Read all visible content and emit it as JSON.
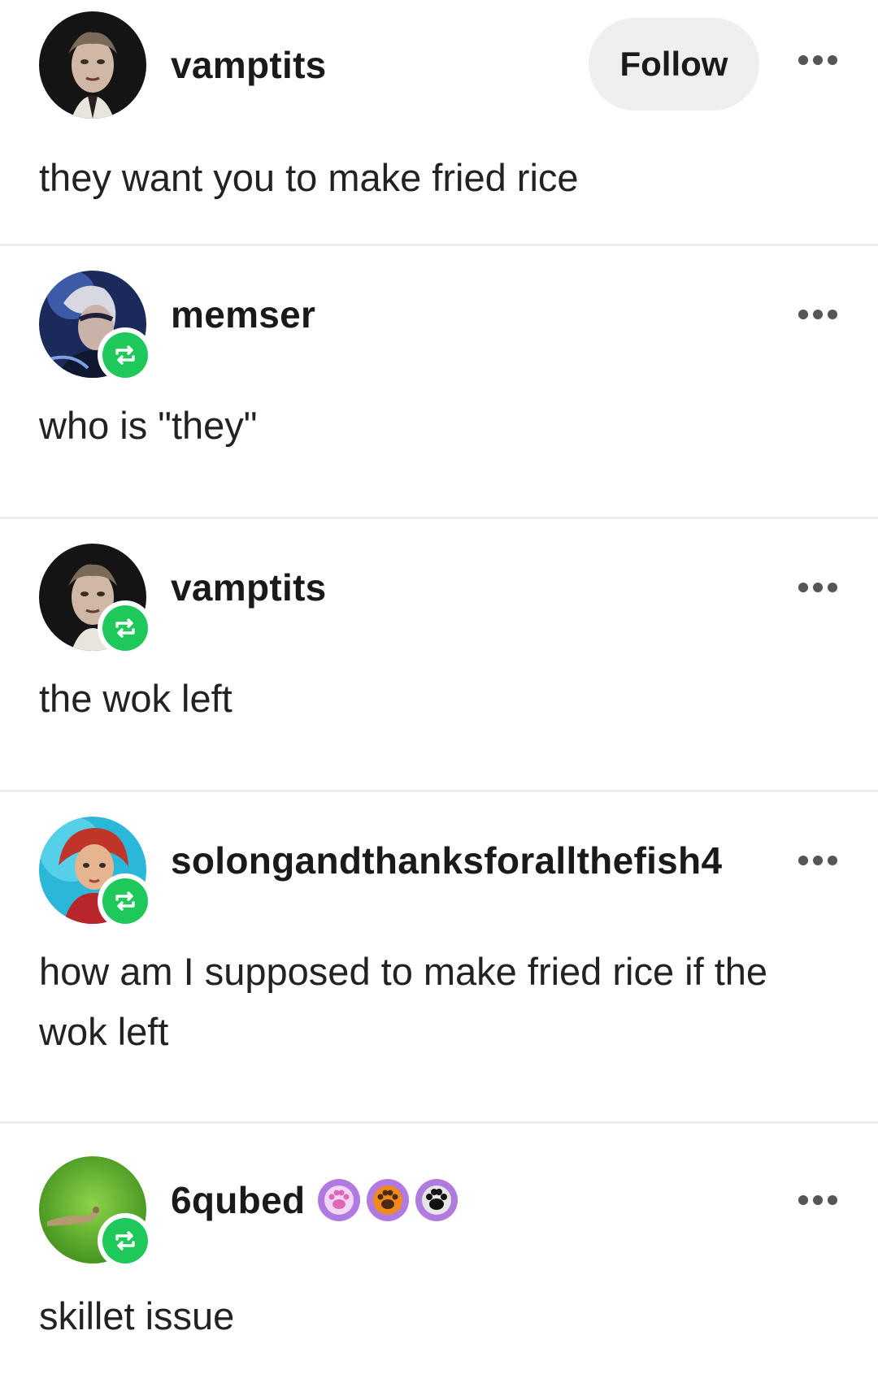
{
  "posts": [
    {
      "username": "vamptits",
      "follow_label": "Follow",
      "text": "they want you to make fried rice",
      "reblog": false
    },
    {
      "username": "memser",
      "text": "who is \"they\"",
      "reblog": true
    },
    {
      "username": "vamptits",
      "text": "the wok left",
      "reblog": true
    },
    {
      "username": "solongandthanksforallthefish4",
      "text": "how am I supposed to make fried rice if the wok left",
      "reblog": true
    },
    {
      "username": "6qubed",
      "text": "skillet issue",
      "reblog": true,
      "badges": [
        "paw-badge-pink",
        "paw-badge-orange",
        "paw-badge-black"
      ]
    }
  ],
  "colors": {
    "reblog_green": "#1fc85a",
    "follow_bg": "#efefef",
    "divider": "#ececec"
  }
}
